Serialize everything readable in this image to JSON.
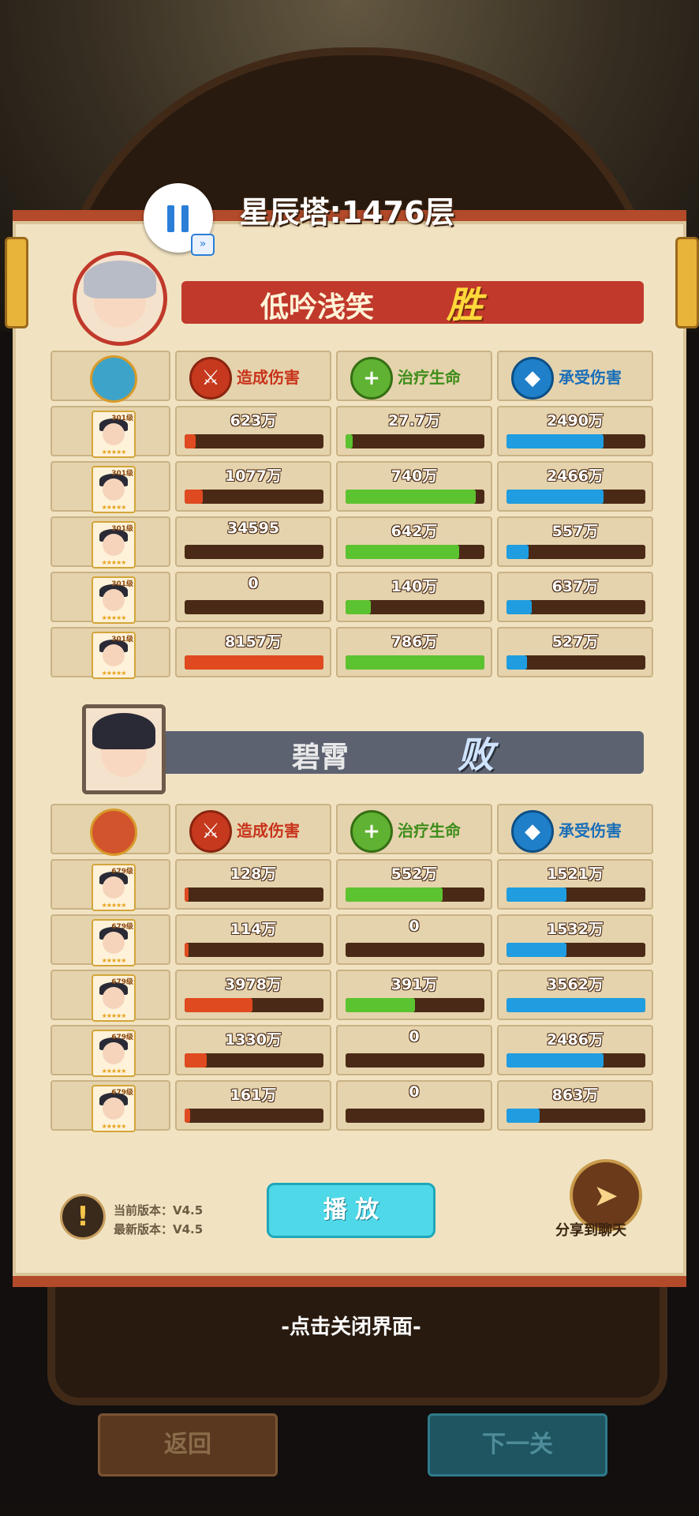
{
  "title": "星辰塔:1476层",
  "team_win": {
    "name": "低吟浅笑",
    "result": "胜"
  },
  "team_lose": {
    "name": "碧霄",
    "result": "败"
  },
  "headers": {
    "damage": "造成伤害",
    "heal": "治疗生命",
    "taken": "承受伤害"
  },
  "rows_win": [
    {
      "level": "301级",
      "damage": "623万",
      "damage_pct": 0.08,
      "heal": "27.7万",
      "heal_pct": 0.05,
      "taken": "2490万",
      "taken_pct": 0.7
    },
    {
      "level": "301级",
      "damage": "1077万",
      "damage_pct": 0.13,
      "heal": "740万",
      "heal_pct": 0.94,
      "taken": "2466万",
      "taken_pct": 0.7
    },
    {
      "level": "301级",
      "damage": "34595",
      "damage_pct": 0.0,
      "heal": "642万",
      "heal_pct": 0.82,
      "taken": "557万",
      "taken_pct": 0.16
    },
    {
      "level": "301级",
      "damage": "0",
      "damage_pct": 0.0,
      "heal": "140万",
      "heal_pct": 0.18,
      "taken": "637万",
      "taken_pct": 0.18
    },
    {
      "level": "301级",
      "damage": "8157万",
      "damage_pct": 1.0,
      "heal": "786万",
      "heal_pct": 1.0,
      "taken": "527万",
      "taken_pct": 0.15
    }
  ],
  "rows_lose": [
    {
      "level": "679级",
      "damage": "128万",
      "damage_pct": 0.03,
      "heal": "552万",
      "heal_pct": 0.7,
      "taken": "1521万",
      "taken_pct": 0.43
    },
    {
      "level": "679级",
      "damage": "114万",
      "damage_pct": 0.03,
      "heal": "0",
      "heal_pct": 0.0,
      "taken": "1532万",
      "taken_pct": 0.43
    },
    {
      "level": "679级",
      "damage": "3978万",
      "damage_pct": 0.49,
      "heal": "391万",
      "heal_pct": 0.5,
      "taken": "3562万",
      "taken_pct": 1.0
    },
    {
      "level": "679级",
      "damage": "1330万",
      "damage_pct": 0.16,
      "heal": "0",
      "heal_pct": 0.0,
      "taken": "2486万",
      "taken_pct": 0.7
    },
    {
      "level": "679级",
      "damage": "161万",
      "damage_pct": 0.04,
      "heal": "0",
      "heal_pct": 0.0,
      "taken": "863万",
      "taken_pct": 0.24
    }
  ],
  "stars": "★★★★★",
  "version": {
    "current": "当前版本：V4.5",
    "latest": "最新版本：V4.5"
  },
  "buttons": {
    "play": "播 放",
    "share": "分享到聊天",
    "back": "返回",
    "next": "下一关"
  },
  "close_hint": "-点击关闭界面-",
  "icons": {
    "warning": "!",
    "share": "➤",
    "damage": "⚔",
    "heal": "+",
    "defense": "◆"
  },
  "colors": {
    "damage": "#e04a20",
    "heal": "#5cc330",
    "taken": "#1f9de0"
  }
}
